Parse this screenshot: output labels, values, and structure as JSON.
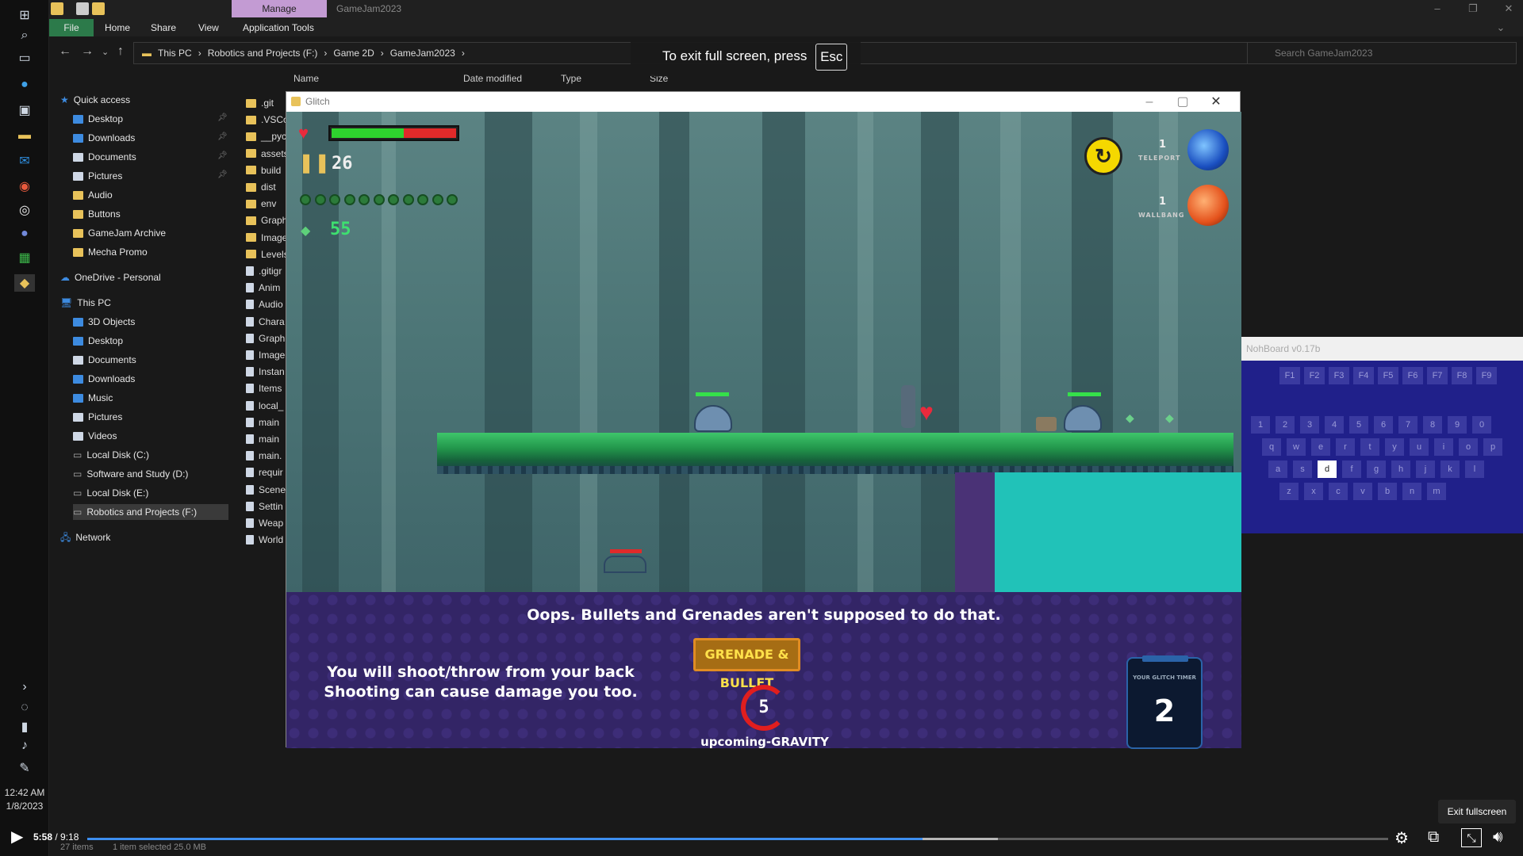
{
  "taskbar": {
    "time": "12:42 AM",
    "date": "1/8/2023"
  },
  "explorer": {
    "context_tab": "Manage",
    "window_title": "GameJam2023",
    "ribbon_tabs": [
      "File",
      "Home",
      "Share",
      "View",
      "Application Tools"
    ],
    "breadcrumb": [
      "This PC",
      "Robotics and Projects (F:)",
      "Game 2D",
      "GameJam2023"
    ],
    "search_placeholder": "Search GameJam2023",
    "columns": [
      "Name",
      "Date modified",
      "Type",
      "Size"
    ],
    "nav_items": [
      {
        "label": "Quick access",
        "kind": "star"
      },
      {
        "label": "Desktop",
        "kind": "blue"
      },
      {
        "label": "Downloads",
        "kind": "blue"
      },
      {
        "label": "Documents",
        "kind": "doc"
      },
      {
        "label": "Pictures",
        "kind": "doc"
      },
      {
        "label": "Audio",
        "kind": "folder"
      },
      {
        "label": "Buttons",
        "kind": "folder"
      },
      {
        "label": "GameJam Archive",
        "kind": "folder"
      },
      {
        "label": "Mecha Promo",
        "kind": "folder"
      },
      {
        "label": "OneDrive - Personal",
        "kind": "cloud"
      },
      {
        "label": "This PC",
        "kind": "pc"
      },
      {
        "label": "3D Objects",
        "kind": "blue"
      },
      {
        "label": "Desktop",
        "kind": "blue"
      },
      {
        "label": "Documents",
        "kind": "doc"
      },
      {
        "label": "Downloads",
        "kind": "blue"
      },
      {
        "label": "Music",
        "kind": "blue"
      },
      {
        "label": "Pictures",
        "kind": "doc"
      },
      {
        "label": "Videos",
        "kind": "doc"
      },
      {
        "label": "Local Disk (C:)",
        "kind": "drive"
      },
      {
        "label": "Software and Study (D:)",
        "kind": "drive"
      },
      {
        "label": "Local Disk (E:)",
        "kind": "drive"
      },
      {
        "label": "Robotics and Projects (F:)",
        "kind": "drive"
      },
      {
        "label": "Network",
        "kind": "network"
      }
    ],
    "files": [
      ".git",
      ".VSCo",
      "__pyc",
      "assets",
      "build",
      "dist",
      "env",
      "Graph",
      "Image",
      "Levels",
      ".gitigr",
      "Anim",
      "Audio",
      "Chara",
      "Graph",
      "Image",
      "Instan",
      "Items",
      "local_",
      "main",
      "main",
      "main.",
      "requir",
      "Scene",
      "Settin",
      "Weap",
      "World"
    ],
    "status_items": "27 items",
    "status_selected": "1 item selected  25.0 MB"
  },
  "fullscreen_notice": {
    "text": "To exit full screen, press",
    "key": "Esc"
  },
  "game": {
    "window_title": "Glitch",
    "hud": {
      "health_fraction": 0.58,
      "ammo": "26",
      "beads_count": 11,
      "gems": "55",
      "teleport_count": "1",
      "teleport_label": "TELEPORT",
      "wallbang_count": "1",
      "wallbang_label": "WALLBANG"
    },
    "message": "Oops. Bullets and Grenades aren't supposed to do that.",
    "description_line1": "You will shoot/throw from your back",
    "description_line2": "Shooting can cause damage you too.",
    "glitch_name": "GRENADE & BULLET",
    "timer": "5",
    "upcoming": "upcoming-GRAVITY",
    "card_label": "YOUR GLITCH TIMER",
    "card_value": "2"
  },
  "nohboard": {
    "title": "NohBoard v0.17b",
    "row_fn": [
      "F1",
      "F2",
      "F3",
      "F4",
      "F5",
      "F6",
      "F7",
      "F8",
      "F9"
    ],
    "row_num": [
      "1",
      "2",
      "3",
      "4",
      "5",
      "6",
      "7",
      "8",
      "9",
      "0"
    ],
    "row_q": [
      "q",
      "w",
      "e",
      "r",
      "t",
      "y",
      "u",
      "i",
      "o",
      "p"
    ],
    "row_a": [
      "a",
      "s",
      "d",
      "f",
      "g",
      "h",
      "j",
      "k",
      "l"
    ],
    "row_z": [
      "z",
      "x",
      "c",
      "v",
      "b",
      "n",
      "m"
    ],
    "pressed_key": "d"
  },
  "player": {
    "current_time": "5:58",
    "duration": "9:18",
    "played_fraction": 0.642,
    "buffered_fraction": 0.7,
    "tooltip": "Exit fullscreen",
    "accent": "#3d8ef0"
  }
}
